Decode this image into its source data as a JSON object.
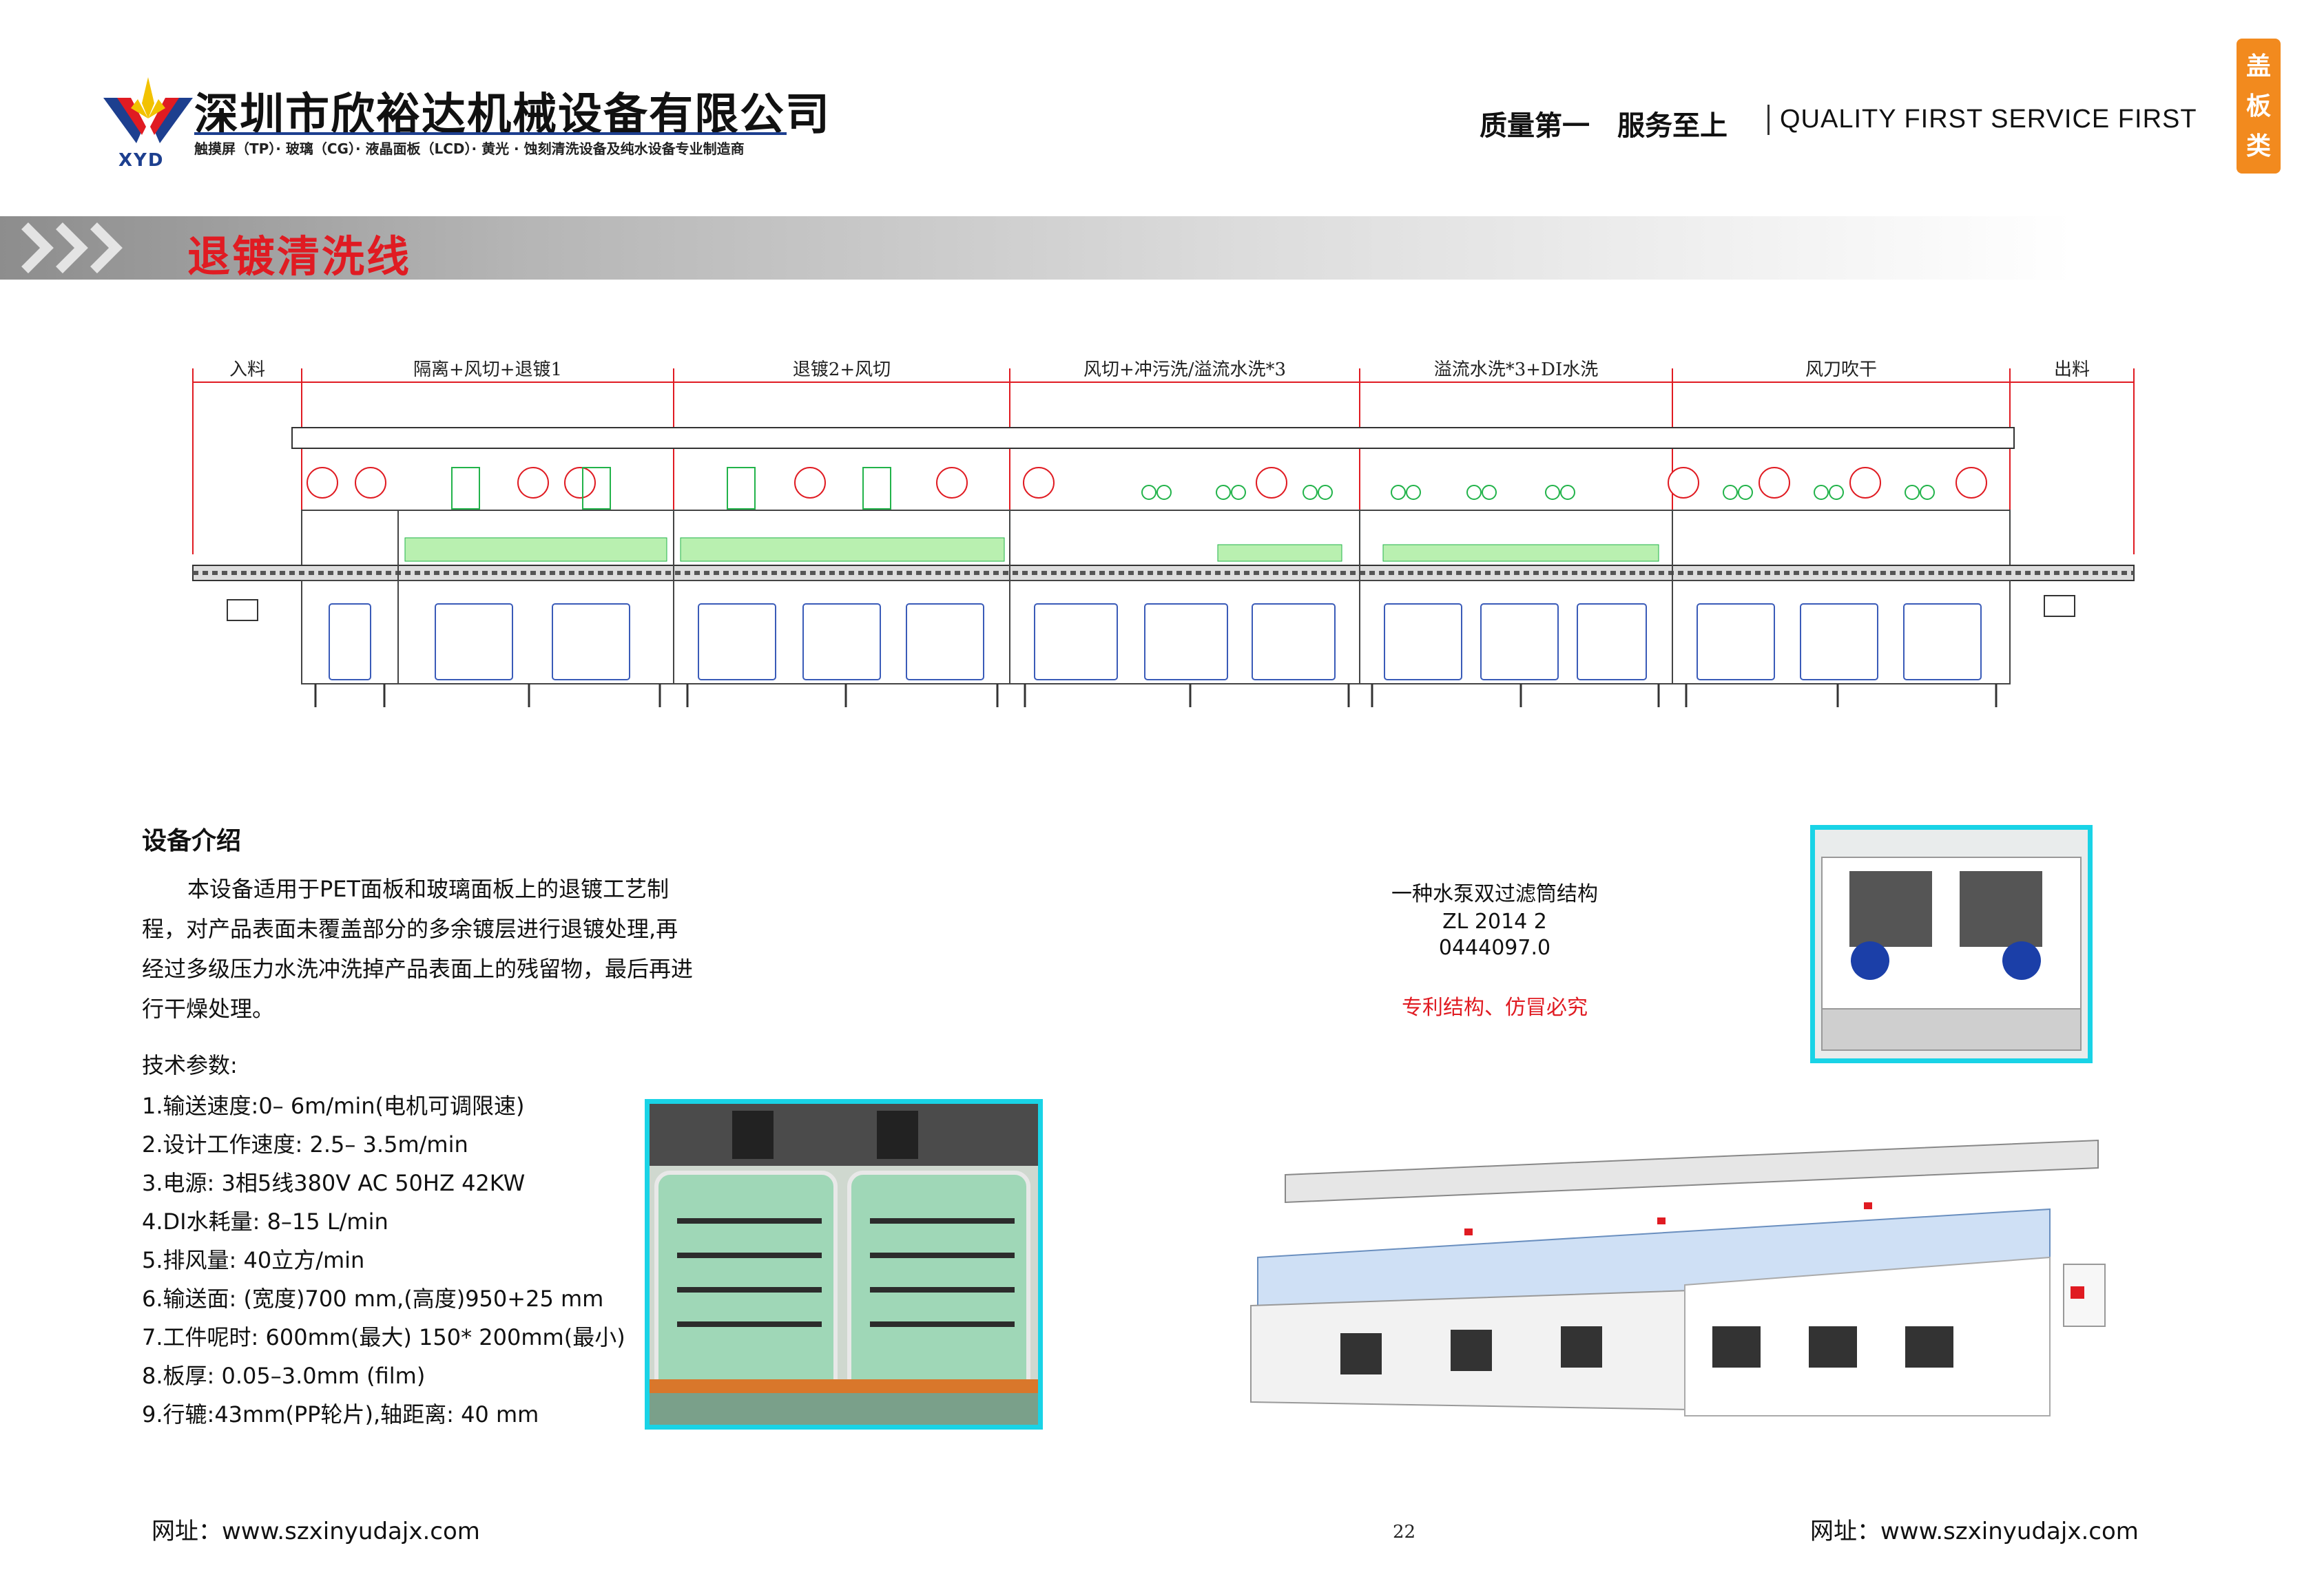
{
  "header": {
    "logo_text": "XYD",
    "company_name": "深圳市欣裕达机械设备有限公司",
    "company_sub": "触摸屏（TP）· 玻璃（CG）· 液晶面板（LCD）· 黄光 · 蚀刻清洗设备及纯水设备专业制造商",
    "slogan_cn": "质量第一　服务至上",
    "slogan_en": "QUALITY FIRST SERVICE FIRST",
    "category_tab": [
      "盖",
      "板",
      "类"
    ]
  },
  "banner": {
    "title": "退镀清洗线"
  },
  "diagram": {
    "sections": [
      "入料",
      "隔离+风切+退镀1",
      "退镀2+风切",
      "风切+冲污洗/溢流水洗*3",
      "溢流水洗*3+DI水洗",
      "风刀吹干",
      "出料"
    ]
  },
  "intro": {
    "heading": "设备介绍",
    "paragraph": "本设备适用于PET面板和玻璃面板上的退镀工艺制程，对产品表面未覆盖部分的多余镀层进行退镀处理,再经过多级压力水洗冲洗掉产品表面上的残留物，最后再进行干燥处理。",
    "tech_title": "技术参数:",
    "params": [
      "1.输送速度:0– 6m/min(电机可调限速)",
      "2.设计工作速度: 2.5– 3.5m/min",
      "3.电源: 3相5线380V AC 50HZ 42KW",
      "4.DI水耗量: 8–15 L/min",
      "5.排风量: 40立方/min",
      "6.输送面: (宽度)700 mm,(高度)950+25 mm",
      "7.工件呢时: 600mm(最大) 150* 200mm(最小)",
      "8.板厚: 0.05–3.0mm (film)",
      "9.行辘:43mm(PP轮片),轴距离: 40 mm"
    ]
  },
  "patent": {
    "title": "一种水泵双过滤筒结构",
    "number": "ZL 2014 2 0444097.0",
    "note": "专利结构、仿冒必究"
  },
  "footer": {
    "website_left": "网址：www.szxinyudajx.com",
    "page_number": "22",
    "website_right": "网址：www.szxinyudajx.com"
  },
  "colors": {
    "accent_red": "#e01b22",
    "frame_cyan": "#19d3e6",
    "tab_orange": "#f28a1e",
    "logo_blue": "#1d3f8f"
  }
}
